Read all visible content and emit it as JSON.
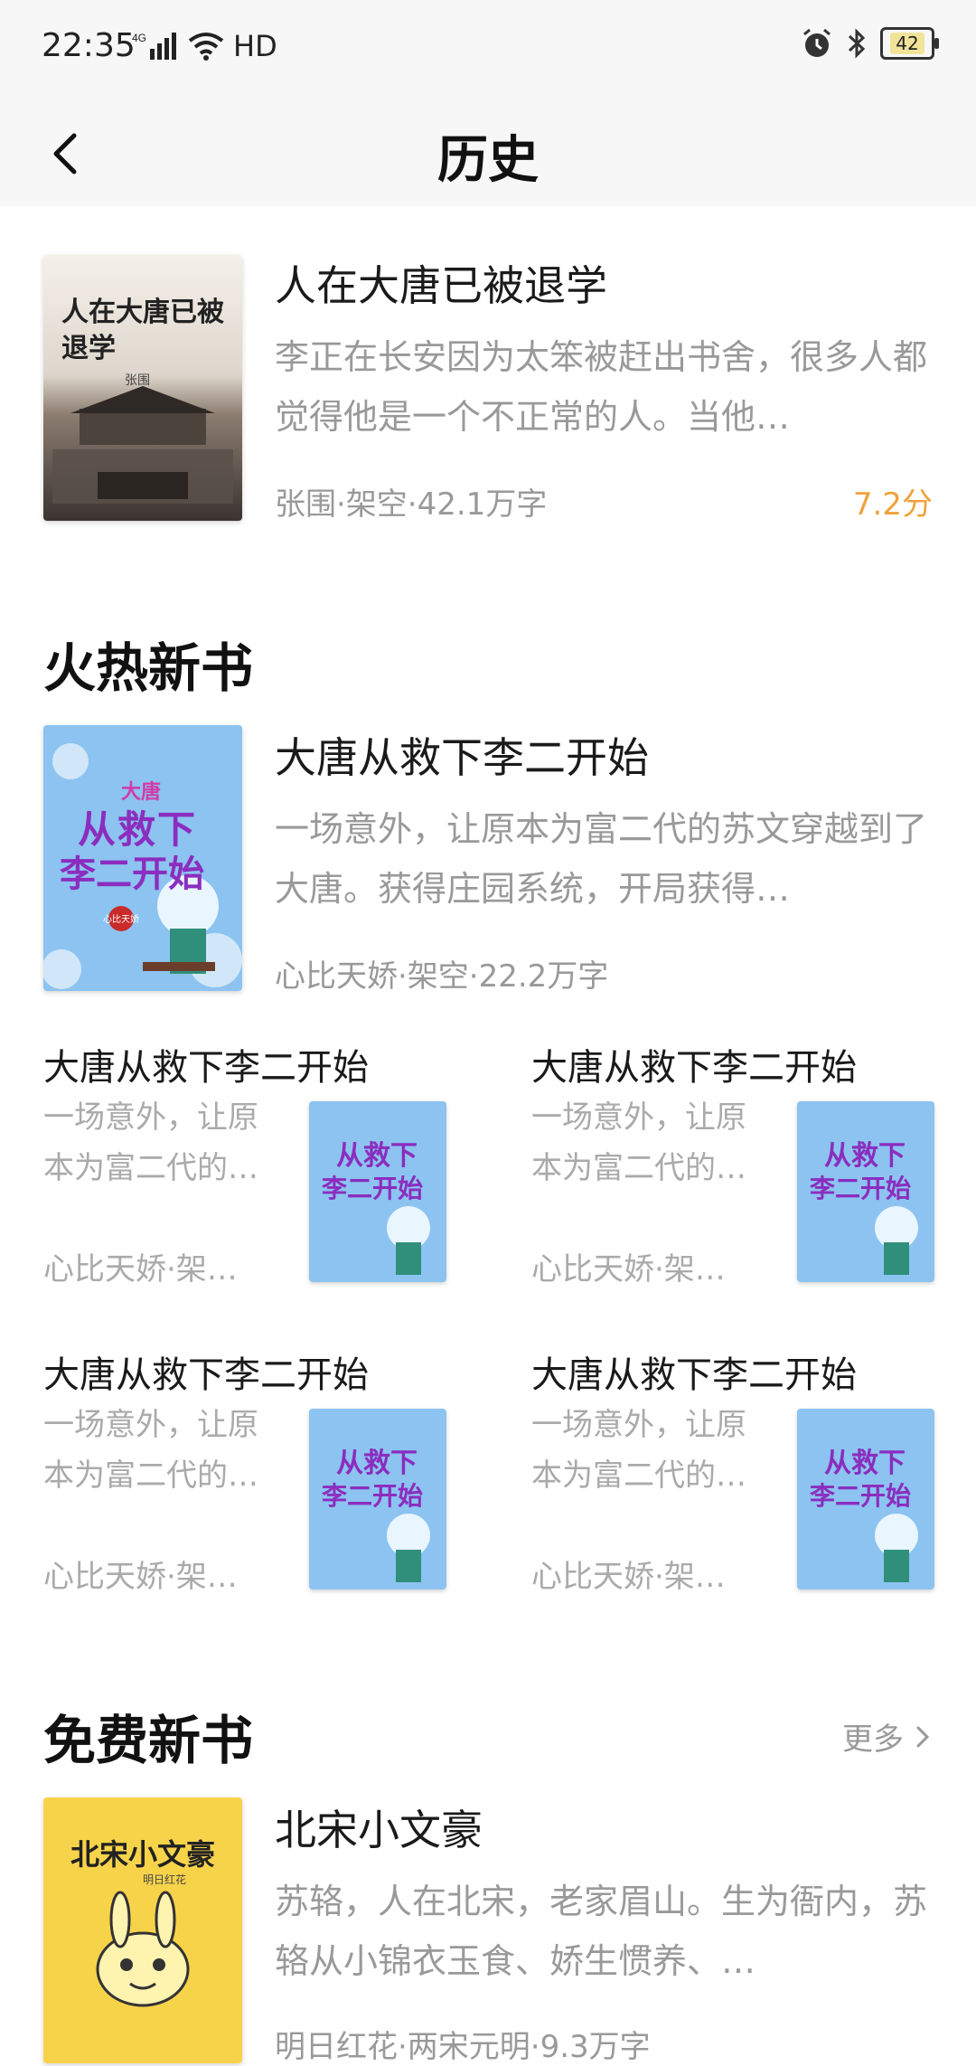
{
  "status_bar": {
    "time": "22:35",
    "network": "4G",
    "hd": "HD",
    "battery": "42"
  },
  "header": {
    "title": "历史"
  },
  "history_book": {
    "title": "人在大唐已被退学",
    "description": "李正在长安因为太笨被赶出书舍，很多人都觉得他是一个不正常的人。当他…",
    "meta": "张围·架空·42.1万字",
    "rating": "7.2分",
    "cover_text": "人在大唐已被退学",
    "cover_author": "张围"
  },
  "hot_section": {
    "title": "火热新书",
    "featured": {
      "title": "大唐从救下李二开始",
      "description": "一场意外，让原本为富二代的苏文穿越到了大唐。获得庄园系统，开局获得…",
      "meta": "心比天娇·架空·22.2万字",
      "cover_text_top": "大唐",
      "cover_text_main1": "从救下",
      "cover_text_main2": "李二开始",
      "cover_author": "心比天娇"
    },
    "grid": [
      {
        "title": "大唐从救下李二开始",
        "description": "一场意外，让原本为富二代的…",
        "meta": "心比天娇·架…"
      },
      {
        "title": "大唐从救下李二开始",
        "description": "一场意外，让原本为富二代的…",
        "meta": "心比天娇·架…"
      },
      {
        "title": "大唐从救下李二开始",
        "description": "一场意外，让原本为富二代的…",
        "meta": "心比天娇·架…"
      },
      {
        "title": "大唐从救下李二开始",
        "description": "一场意外，让原本为富二代的…",
        "meta": "心比天娇·架…"
      }
    ]
  },
  "free_section": {
    "title": "免费新书",
    "more_label": "更多",
    "book": {
      "title": "北宋小文豪",
      "description": "苏辂，人在北宋，老家眉山。生为衙内，苏辂从小锦衣玉食、娇生惯养、…",
      "meta": "明日红花·两宋元明·9.3万字",
      "cover_text": "北宋小文豪",
      "cover_author": "明日红花"
    }
  },
  "colors": {
    "accent_rating": "#f0a23a",
    "muted_text": "#999999"
  }
}
